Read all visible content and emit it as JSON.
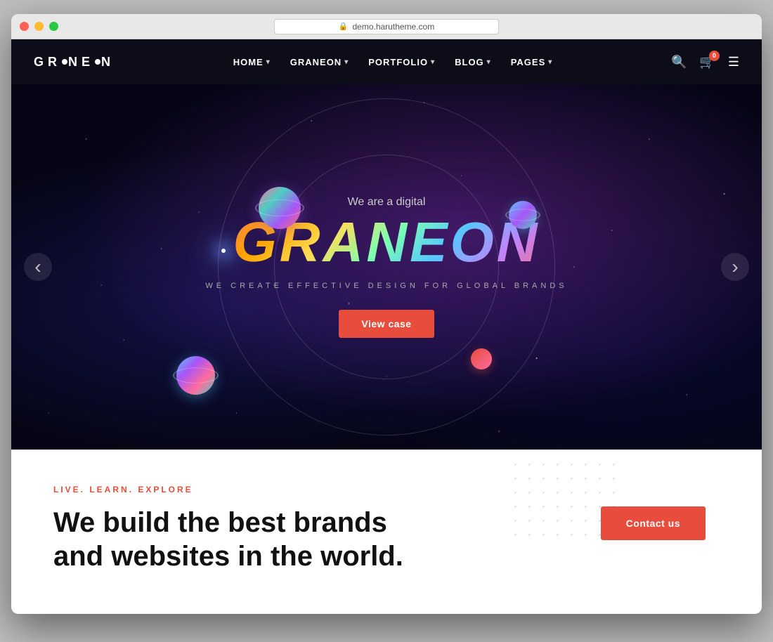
{
  "window": {
    "url": "demo.harutheme.com"
  },
  "navbar": {
    "logo": "GRANEON",
    "menu": [
      {
        "label": "HOME",
        "hasDropdown": true
      },
      {
        "label": "GRANEON",
        "hasDropdown": true
      },
      {
        "label": "PORTFOLIO",
        "hasDropdown": true
      },
      {
        "label": "BLOG",
        "hasDropdown": true
      },
      {
        "label": "PAGES",
        "hasDropdown": true
      }
    ],
    "cart_count": "0"
  },
  "hero": {
    "subtitle": "We are a digital",
    "title": "GRANEON",
    "tagline": "WE CREATE EFFECTIVE DESIGN FOR GLOBAL BRANDS",
    "cta_button": "View case"
  },
  "slider": {
    "prev_arrow": "‹",
    "next_arrow": "›"
  },
  "below_fold": {
    "eyebrow": "LIVE. LEARN. EXPLORE",
    "headline": "We build the best brands and websites in the world.",
    "contact_button": "Contact us"
  }
}
